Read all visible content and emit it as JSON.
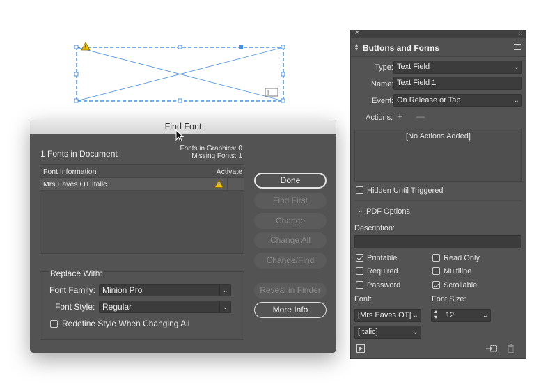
{
  "find_font": {
    "title": "Find Font",
    "fonts_count": "1 Fonts in Document",
    "fonts_in_graphics": "Fonts in Graphics: 0",
    "missing_fonts": "Missing Fonts: 1",
    "table": {
      "col_info": "Font Information",
      "col_activate": "Activate",
      "rows": [
        {
          "name": "Mrs Eaves OT Italic",
          "status_icon": "warning-icon"
        }
      ]
    },
    "buttons": {
      "done": "Done",
      "find_first": "Find First",
      "change": "Change",
      "change_all": "Change All",
      "change_find": "Change/Find",
      "reveal": "Reveal in Finder",
      "more_info": "More Info"
    },
    "replace": {
      "title": "Replace With:",
      "family_label": "Font Family:",
      "family_value": "Minion Pro",
      "style_label": "Font Style:",
      "style_value": "Regular",
      "redefine_label": "Redefine Style When Changing All",
      "redefine_checked": false
    }
  },
  "panel": {
    "title": "Buttons and Forms",
    "type_label": "Type:",
    "type_value": "Text Field",
    "name_label": "Name:",
    "name_value": "Text Field 1",
    "event_label": "Event:",
    "event_value": "On Release or Tap",
    "actions_label": "Actions:",
    "actions_add": "+",
    "actions_remove": "—",
    "no_actions": "[No Actions Added]",
    "hidden_label": "Hidden Until Triggered",
    "hidden_checked": false,
    "pdf_options": "PDF Options",
    "description_label": "Description:",
    "description_value": "",
    "options": {
      "printable": {
        "label": "Printable",
        "checked": true
      },
      "read_only": {
        "label": "Read Only",
        "checked": false
      },
      "required": {
        "label": "Required",
        "checked": false
      },
      "multiline": {
        "label": "Multiline",
        "checked": false
      },
      "password": {
        "label": "Password",
        "checked": false
      },
      "scrollable": {
        "label": "Scrollable",
        "checked": true
      }
    },
    "font_label": "Font:",
    "font_value": "[Mrs Eaves OT]",
    "font_style_value": "[Italic]",
    "font_size_label": "Font Size:",
    "font_size_value": "12"
  },
  "colors": {
    "frame_blue": "#4a90e2",
    "dialog_bg": "#535353",
    "warning_yellow": "#f5c400"
  }
}
